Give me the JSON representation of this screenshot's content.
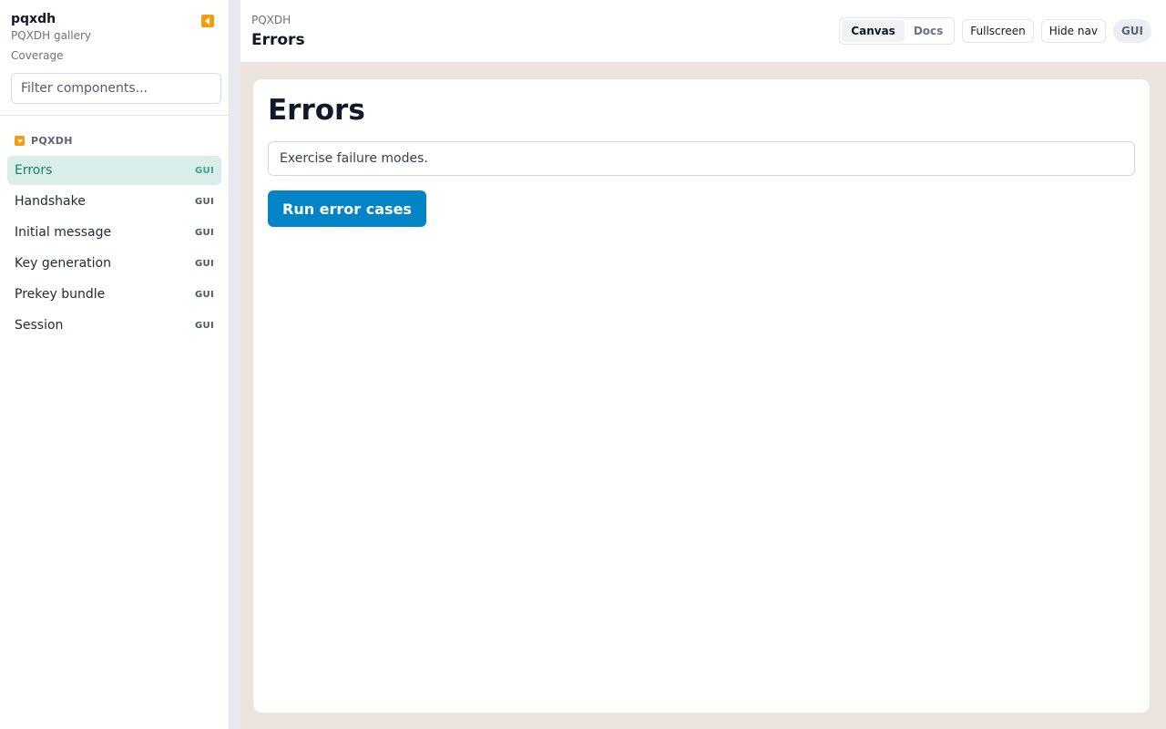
{
  "sidebar": {
    "title": "pqxdh",
    "subtitle": "PQXDH gallery",
    "coverage_link": "Coverage",
    "filter_placeholder": "Filter components...",
    "group": {
      "label": "PQXDH",
      "items": [
        {
          "label": "Errors",
          "badge": "GUI",
          "active": true
        },
        {
          "label": "Handshake",
          "badge": "GUI"
        },
        {
          "label": "Initial message",
          "badge": "GUI"
        },
        {
          "label": "Key generation",
          "badge": "GUI"
        },
        {
          "label": "Prekey bundle",
          "badge": "GUI"
        },
        {
          "label": "Session",
          "badge": "GUI"
        }
      ]
    }
  },
  "topbar": {
    "breadcrumb": "PQXDH",
    "title": "Errors",
    "view_tabs": [
      "Canvas",
      "Docs"
    ],
    "fullscreen_label": "Fullscreen",
    "hide_nav_label": "Hide nav",
    "mode_badge": "GUI"
  },
  "card": {
    "title": "Errors",
    "description": "Exercise failure modes.",
    "run_button": "Run error cases"
  },
  "colors": {
    "accent": "#0284c7",
    "active_nav_bg": "#d9eee9",
    "active_nav_text": "#16826f",
    "toggle_orange": "#f59e0b",
    "canvas_bg": "#ece5de"
  },
  "icons": {
    "collapse": "collapse-left-icon",
    "group_toggle": "chevron-down-icon"
  }
}
